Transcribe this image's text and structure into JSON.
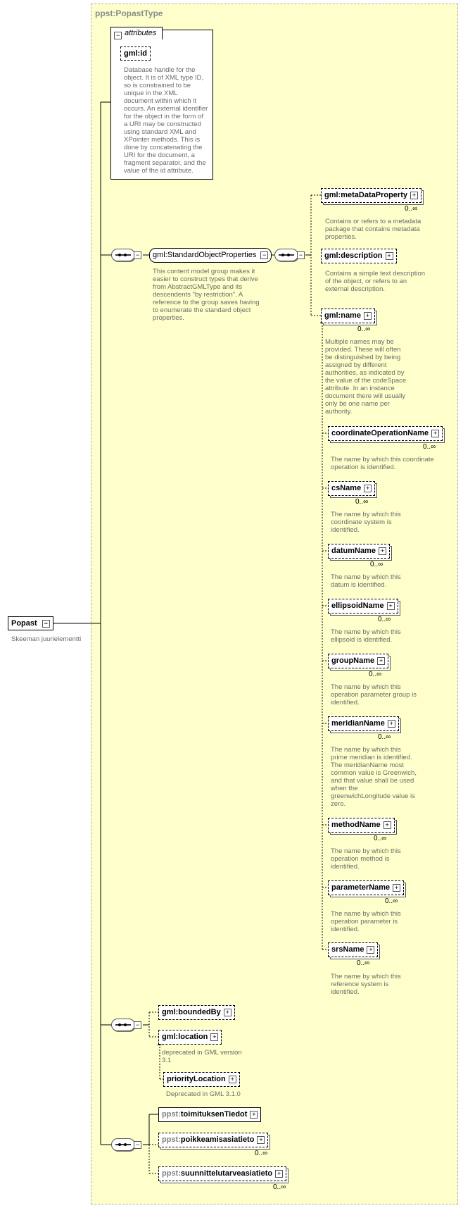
{
  "type_label": "ppst:PopastType",
  "root": {
    "name": "Popast",
    "desc": "Skeeman juurielementti"
  },
  "attributes": {
    "tab": "attributes",
    "id": {
      "name": "gml:id",
      "desc": "Database handle for the object.  It is of XML type ID, so is constrained to be unique in the XML document within which it occurs.  An external identifier for the object in the form of a URI may be constructed using standard XML and XPointer methods.  This is done by concatenating the URI for the document, a fragment separator, and the value of the id attribute."
    }
  },
  "group": {
    "name": "gml:StandardObjectProperties",
    "desc": "This content model group makes it easier to construct types that derive from AbstractGMLType and its descendents \"by restriction\".  A reference to the group saves having to enumerate the standard object properties."
  },
  "std_elements": [
    {
      "name": "gml:metaDataProperty",
      "card": "0..∞",
      "desc": "Contains or refers to a metadata package that contains metadata properties."
    },
    {
      "name": "gml:description",
      "card": "",
      "desc": "Contains a simple text description of the object, or refers to an external description."
    },
    {
      "name": "gml:name",
      "card": "0..∞",
      "desc": "Multiple names may be provided.  These will often be distinguished by being assigned by different authorities, as indicated by the value of the codeSpace attribute.  In an instance document there will usually only be one name per authority."
    }
  ],
  "name_subs": [
    {
      "name": "coordinateOperationName",
      "card": "0..∞",
      "desc": "The name by which this coordinate operation is identified."
    },
    {
      "name": "csName",
      "card": "0..∞",
      "desc": "The name by which this coordinate system is identified."
    },
    {
      "name": "datumName",
      "card": "0..∞",
      "desc": "The name by which this datum is identified."
    },
    {
      "name": "ellipsoidName",
      "card": "0..∞",
      "desc": "The name by which this ellipsoid is identified."
    },
    {
      "name": "groupName",
      "card": "0..∞",
      "desc": "The name by which this operation parameter group is identified."
    },
    {
      "name": "meridianName",
      "card": "0..∞",
      "desc": "The name by which this prime meridian is identified. The meridianName most common value is Greenwich, and that value shall be used when the greenwichLongitude value is zero."
    },
    {
      "name": "methodName",
      "card": "0..∞",
      "desc": "The name by which this operation method is identified."
    },
    {
      "name": "parameterName",
      "card": "0..∞",
      "desc": "The name by which this operation parameter is identified."
    },
    {
      "name": "srsName",
      "card": "0..∞",
      "desc": "The name by which this reference system is identified."
    }
  ],
  "feature": [
    {
      "name": "gml:boundedBy",
      "desc": ""
    },
    {
      "name": "gml:location",
      "desc": "deprecated in GML version 3.1"
    },
    {
      "name": "priorityLocation",
      "desc": "Deprecated in GML 3.1.0"
    }
  ],
  "ppst": [
    {
      "prefix": "ppst:",
      "name": "toimituksenTiedot",
      "card": ""
    },
    {
      "prefix": "ppst:",
      "name": "poikkeamisasiatieto",
      "card": "0..∞"
    },
    {
      "prefix": "ppst:",
      "name": "suunnittelutarveasiatieto",
      "card": "0..∞"
    }
  ],
  "icons": {
    "expand": "+",
    "collapse": "−"
  }
}
